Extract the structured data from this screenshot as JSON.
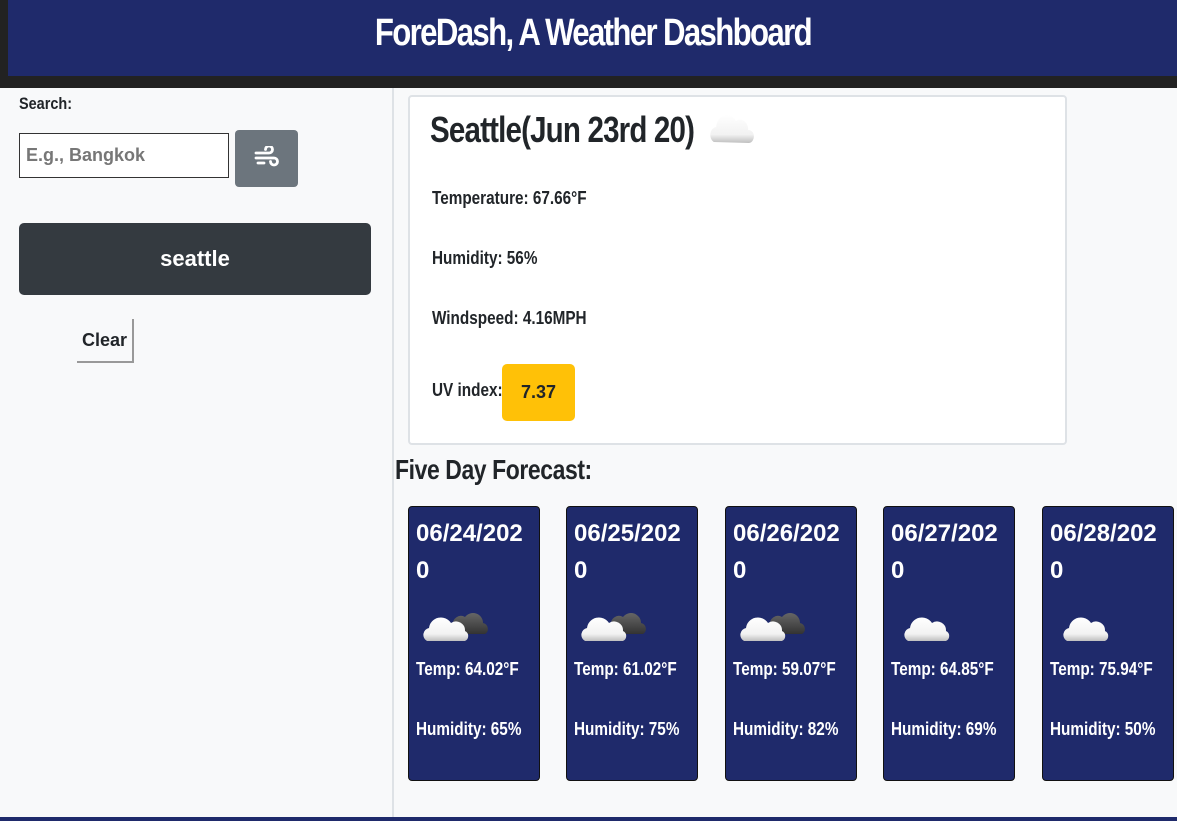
{
  "header": {
    "title": "ForeDash, A Weather Dashboard"
  },
  "sidebar": {
    "search_label": "Search:",
    "search_placeholder": "E.g., Bangkok",
    "search_button_icon": "wind-icon",
    "history": [
      {
        "label": "seattle"
      }
    ],
    "clear_label": "Clear"
  },
  "current": {
    "city_title": "Seattle(Jun 23rd 20)",
    "icon": "cloud-icon",
    "temperature": "Temperature: 67.66°F",
    "humidity": "Humidity: 56%",
    "windspeed": "Windspeed: 4.16MPH",
    "uv_label": "UV index:",
    "uv_value": "7.37",
    "uv_color": "#ffc107"
  },
  "forecast": {
    "heading": "Five Day Forecast:",
    "days": [
      {
        "date": "06/24/2020",
        "icon": "partly-cloudy-icon",
        "temp": "Temp: 64.02°F",
        "humidity": "Humidity: 65%"
      },
      {
        "date": "06/25/2020",
        "icon": "partly-cloudy-icon",
        "temp": "Temp: 61.02°F",
        "humidity": "Humidity: 75%"
      },
      {
        "date": "06/26/2020",
        "icon": "partly-cloudy-icon",
        "temp": "Temp: 59.07°F",
        "humidity": "Humidity: 82%"
      },
      {
        "date": "06/27/2020",
        "icon": "cloud-icon",
        "temp": "Temp: 64.85°F",
        "humidity": "Humidity: 69%"
      },
      {
        "date": "06/28/2020",
        "icon": "cloud-icon",
        "temp": "Temp: 75.94°F",
        "humidity": "Humidity: 50%"
      }
    ]
  },
  "colors": {
    "navy": "#1f2a6b",
    "dark_button": "#343a40",
    "gray_button": "#6c757d",
    "uv_warning": "#ffc107"
  }
}
